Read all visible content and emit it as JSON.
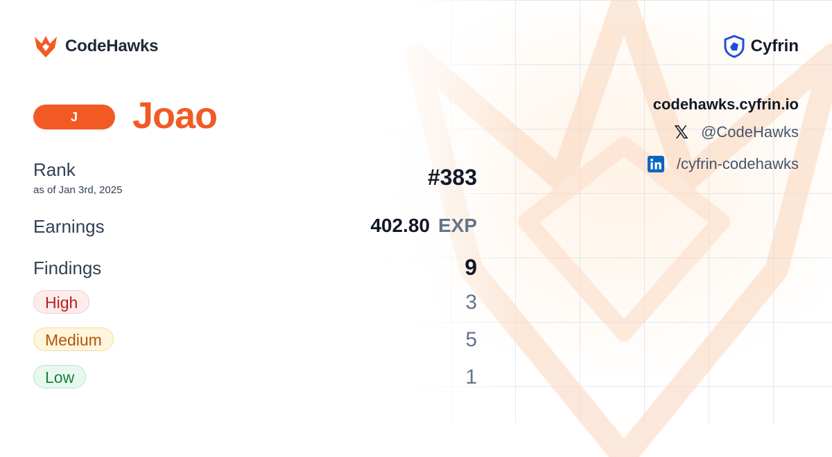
{
  "brand": {
    "name": "CodeHawks",
    "partner": "Cyfrin"
  },
  "profile": {
    "avatar_initial": "J",
    "name": "Joao"
  },
  "stats": {
    "rank_label": "Rank",
    "rank_date": "as of Jan 3rd, 2025",
    "rank_value": "#383",
    "earnings_label": "Earnings",
    "earnings_value": "402.80",
    "earnings_unit": "EXP",
    "findings_label": "Findings",
    "findings_total": "9",
    "severities": [
      {
        "label": "High",
        "count": "3"
      },
      {
        "label": "Medium",
        "count": "5"
      },
      {
        "label": "Low",
        "count": "1"
      }
    ]
  },
  "links": {
    "site": "codehawks.cyfrin.io",
    "twitter": "@CodeHawks",
    "linkedin": "/cyfrin-codehawks"
  },
  "colors": {
    "accent": "#f25a24",
    "high": "#b91c1c",
    "medium": "#b45309",
    "low": "#15803d",
    "linkedin": "#0a66c2",
    "cyfrin": "#1d4ed8"
  },
  "icons": {
    "brand": "hawk-logo-icon",
    "partner": "cyfrin-shield-icon",
    "twitter": "x-icon",
    "linkedin": "linkedin-icon"
  }
}
